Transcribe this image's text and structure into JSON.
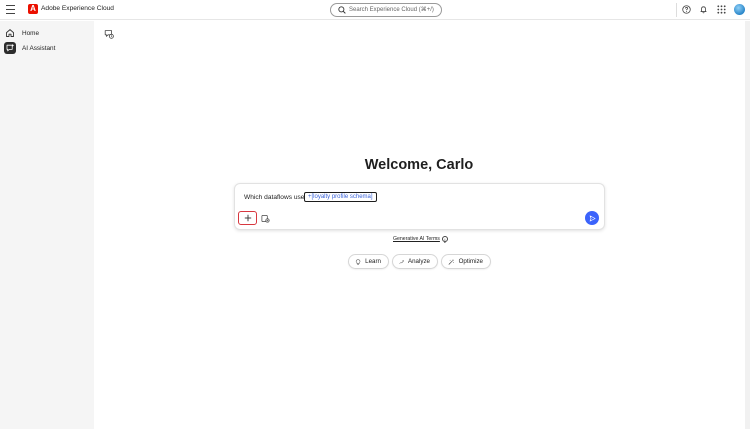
{
  "header": {
    "brand_name": "Adobe Experience Cloud",
    "brand_logo_letter": "A",
    "search_placeholder": "Search Experience Cloud (⌘+/)",
    "icons": [
      "menu-icon",
      "adobe-logo-icon",
      "search-icon",
      "help-icon",
      "bell-icon",
      "apps-grid-icon",
      "avatar"
    ]
  },
  "sidebar": {
    "items": [
      {
        "label": "Home",
        "icon": "home-icon"
      },
      {
        "label": "AI Assistant",
        "icon": "ai-assistant-icon",
        "selected": true
      }
    ]
  },
  "main": {
    "welcome": "Welcome, Carlo",
    "composer": {
      "prompt_text": "Which dataflows use",
      "chip_label": "+[loyalty profile schema]",
      "add_icon": "plus-icon",
      "attach_icon": "attachment-icon",
      "send_icon": "send-icon"
    },
    "terms_label": "Generative AI Terms",
    "terms_info_glyph": "i",
    "suggestions": [
      {
        "label": "Learn",
        "icon": "lightbulb-icon"
      },
      {
        "label": "Analyze",
        "icon": "trend-icon"
      },
      {
        "label": "Optimize",
        "icon": "magic-wand-icon"
      }
    ]
  },
  "colors": {
    "brand_red": "#eb1000",
    "accent_blue": "#3b63fb",
    "highlight_red": "#d7373f",
    "sidebar_bg": "#f5f5f5"
  }
}
